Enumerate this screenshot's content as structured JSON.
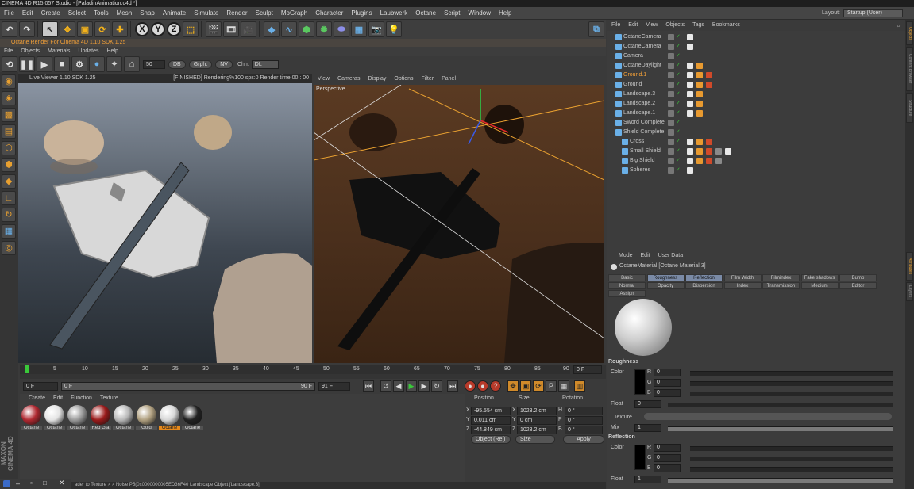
{
  "title": "CINEMA 4D R15.057 Studio - [PaladinAnimation.c4d *]",
  "menu": [
    "File",
    "Edit",
    "Create",
    "Select",
    "Tools",
    "Mesh",
    "Snap",
    "Animate",
    "Simulate",
    "Render",
    "Sculpt",
    "MoGraph",
    "Character",
    "Plugins",
    "Laubwerk",
    "Octane",
    "Script",
    "Window",
    "Help"
  ],
  "layout": {
    "label": "Layout:",
    "value": "Startup (User)"
  },
  "octane": {
    "title": "Octane Render For Cinema 4D 1.10   SDK 1.25",
    "menu": [
      "File",
      "Objects",
      "Materials",
      "Updates",
      "Help"
    ],
    "value": "50",
    "buttons": [
      "DB",
      "Grph.",
      "NV"
    ],
    "chn_label": "Chn:",
    "chn_value": "DL"
  },
  "liveviewer": {
    "title": "Live Viewer 1.10   SDK 1.25",
    "status": "[FINISHED]  Rendering%100 sps:0 Render time:00 : 00"
  },
  "perspective": {
    "menu": [
      "View",
      "Cameras",
      "Display",
      "Options",
      "Filter",
      "Panel"
    ],
    "label": "Perspective"
  },
  "timeline": {
    "ticks": [
      "0",
      "5",
      "10",
      "15",
      "20",
      "25",
      "30",
      "35",
      "40",
      "45",
      "50",
      "55",
      "60",
      "65",
      "70",
      "75",
      "80",
      "85",
      "90"
    ],
    "current": "0 F",
    "start": "0 F",
    "field2": "0 F",
    "end": "90 F",
    "end2": "91 F"
  },
  "materials": {
    "menu": [
      "Create",
      "Edit",
      "Function",
      "Texture"
    ],
    "items": [
      {
        "label": "Octane",
        "color": "#b02830",
        "selected": false
      },
      {
        "label": "Octane",
        "color": "#e4e4e4",
        "selected": false
      },
      {
        "label": "Octane",
        "color": "#9a9a9a",
        "selected": false
      },
      {
        "label": "Red Gla",
        "color": "#9a1a1a",
        "selected": false
      },
      {
        "label": "Octane",
        "color": "#b8b8b8",
        "selected": false
      },
      {
        "label": "Gold",
        "color": "#b0a080",
        "selected": false
      },
      {
        "label": "Octane",
        "color": "#d8d8d8",
        "selected": true
      },
      {
        "label": "Octane",
        "color": "#222222",
        "selected": false
      }
    ]
  },
  "coords": {
    "headers": [
      "Position",
      "Size",
      "Rotation"
    ],
    "rows": [
      {
        "axis": "X",
        "pos": "-95.554 cm",
        "saxis": "X",
        "size": "1023.2 cm",
        "raxis": "H",
        "rot": "0 °"
      },
      {
        "axis": "Y",
        "pos": "0.011 cm",
        "saxis": "Y",
        "size": "0 cm",
        "raxis": "P",
        "rot": "0 °"
      },
      {
        "axis": "Z",
        "pos": "-44.849 cm",
        "saxis": "Z",
        "size": "1023.2 cm",
        "raxis": "B",
        "rot": "0 °"
      }
    ],
    "mode1": "Object (Rel)",
    "mode2": "Size",
    "apply": "Apply"
  },
  "objects": {
    "menu": [
      "File",
      "Edit",
      "View",
      "Objects",
      "Tags",
      "Bookmarks"
    ],
    "items": [
      {
        "name": "OctaneCamera",
        "indent": 0,
        "orange": false,
        "tags": 1
      },
      {
        "name": "OctaneCamera",
        "indent": 0,
        "orange": false,
        "tags": 1
      },
      {
        "name": "Camera",
        "indent": 0,
        "orange": false,
        "tags": 0
      },
      {
        "name": "OctaneDaylight",
        "indent": 0,
        "orange": false,
        "tags": 2
      },
      {
        "name": "Ground.1",
        "indent": 0,
        "orange": true,
        "tags": 3
      },
      {
        "name": "Ground",
        "indent": 0,
        "orange": false,
        "tags": 3
      },
      {
        "name": "Landscape.3",
        "indent": 0,
        "orange": false,
        "tags": 2
      },
      {
        "name": "Landscape.2",
        "indent": 0,
        "orange": false,
        "tags": 2
      },
      {
        "name": "Landscape.1",
        "indent": 0,
        "orange": false,
        "tags": 2
      },
      {
        "name": "Sword Complete",
        "indent": 0,
        "orange": false,
        "tags": 0
      },
      {
        "name": "Shield Complete",
        "indent": 0,
        "orange": false,
        "tags": 0
      },
      {
        "name": "Cross",
        "indent": 1,
        "orange": false,
        "tags": 3
      },
      {
        "name": "Small Shield",
        "indent": 1,
        "orange": false,
        "tags": 5
      },
      {
        "name": "Big Shield",
        "indent": 1,
        "orange": false,
        "tags": 4
      },
      {
        "name": "Spheres",
        "indent": 1,
        "orange": false,
        "tags": 1
      }
    ]
  },
  "attributes": {
    "menu": [
      "Mode",
      "Edit",
      "User Data"
    ],
    "object_name": "OctaneMaterial [Octane Material.3]",
    "tabs_row1": [
      "Basic",
      "Roughness",
      "Reflection",
      "Film Width",
      "Filmindex",
      "Fake shadows",
      "Bump"
    ],
    "tabs_row2": [
      "Normal",
      "Opacity",
      "Dispersion",
      "Index",
      "Transmission",
      "Medium",
      "Editor"
    ],
    "tabs_row3": [
      "Assign"
    ],
    "active_tabs": [
      "Roughness",
      "Reflection"
    ],
    "roughness": {
      "title": "Roughness",
      "color_label": "Color",
      "r": "0",
      "g": "0",
      "b": "0",
      "float_label": "Float",
      "float": "0",
      "texture_label": "Texture",
      "mix_label": "Mix",
      "mix": "1"
    },
    "reflection": {
      "title": "Reflection",
      "color_label": "Color",
      "r": "0",
      "g": "0",
      "b": "0",
      "float_label": "Float",
      "float": "1"
    }
  },
  "status": "ader to Texture > > Noise P5(0x0000000005ED36F40    Landscape Object [Landscape.3]",
  "maxon": "MAXON CINEMA 4D",
  "right_tabs": [
    "Objects",
    "Content Browser",
    "Structure",
    "Attributes",
    "Layers"
  ]
}
